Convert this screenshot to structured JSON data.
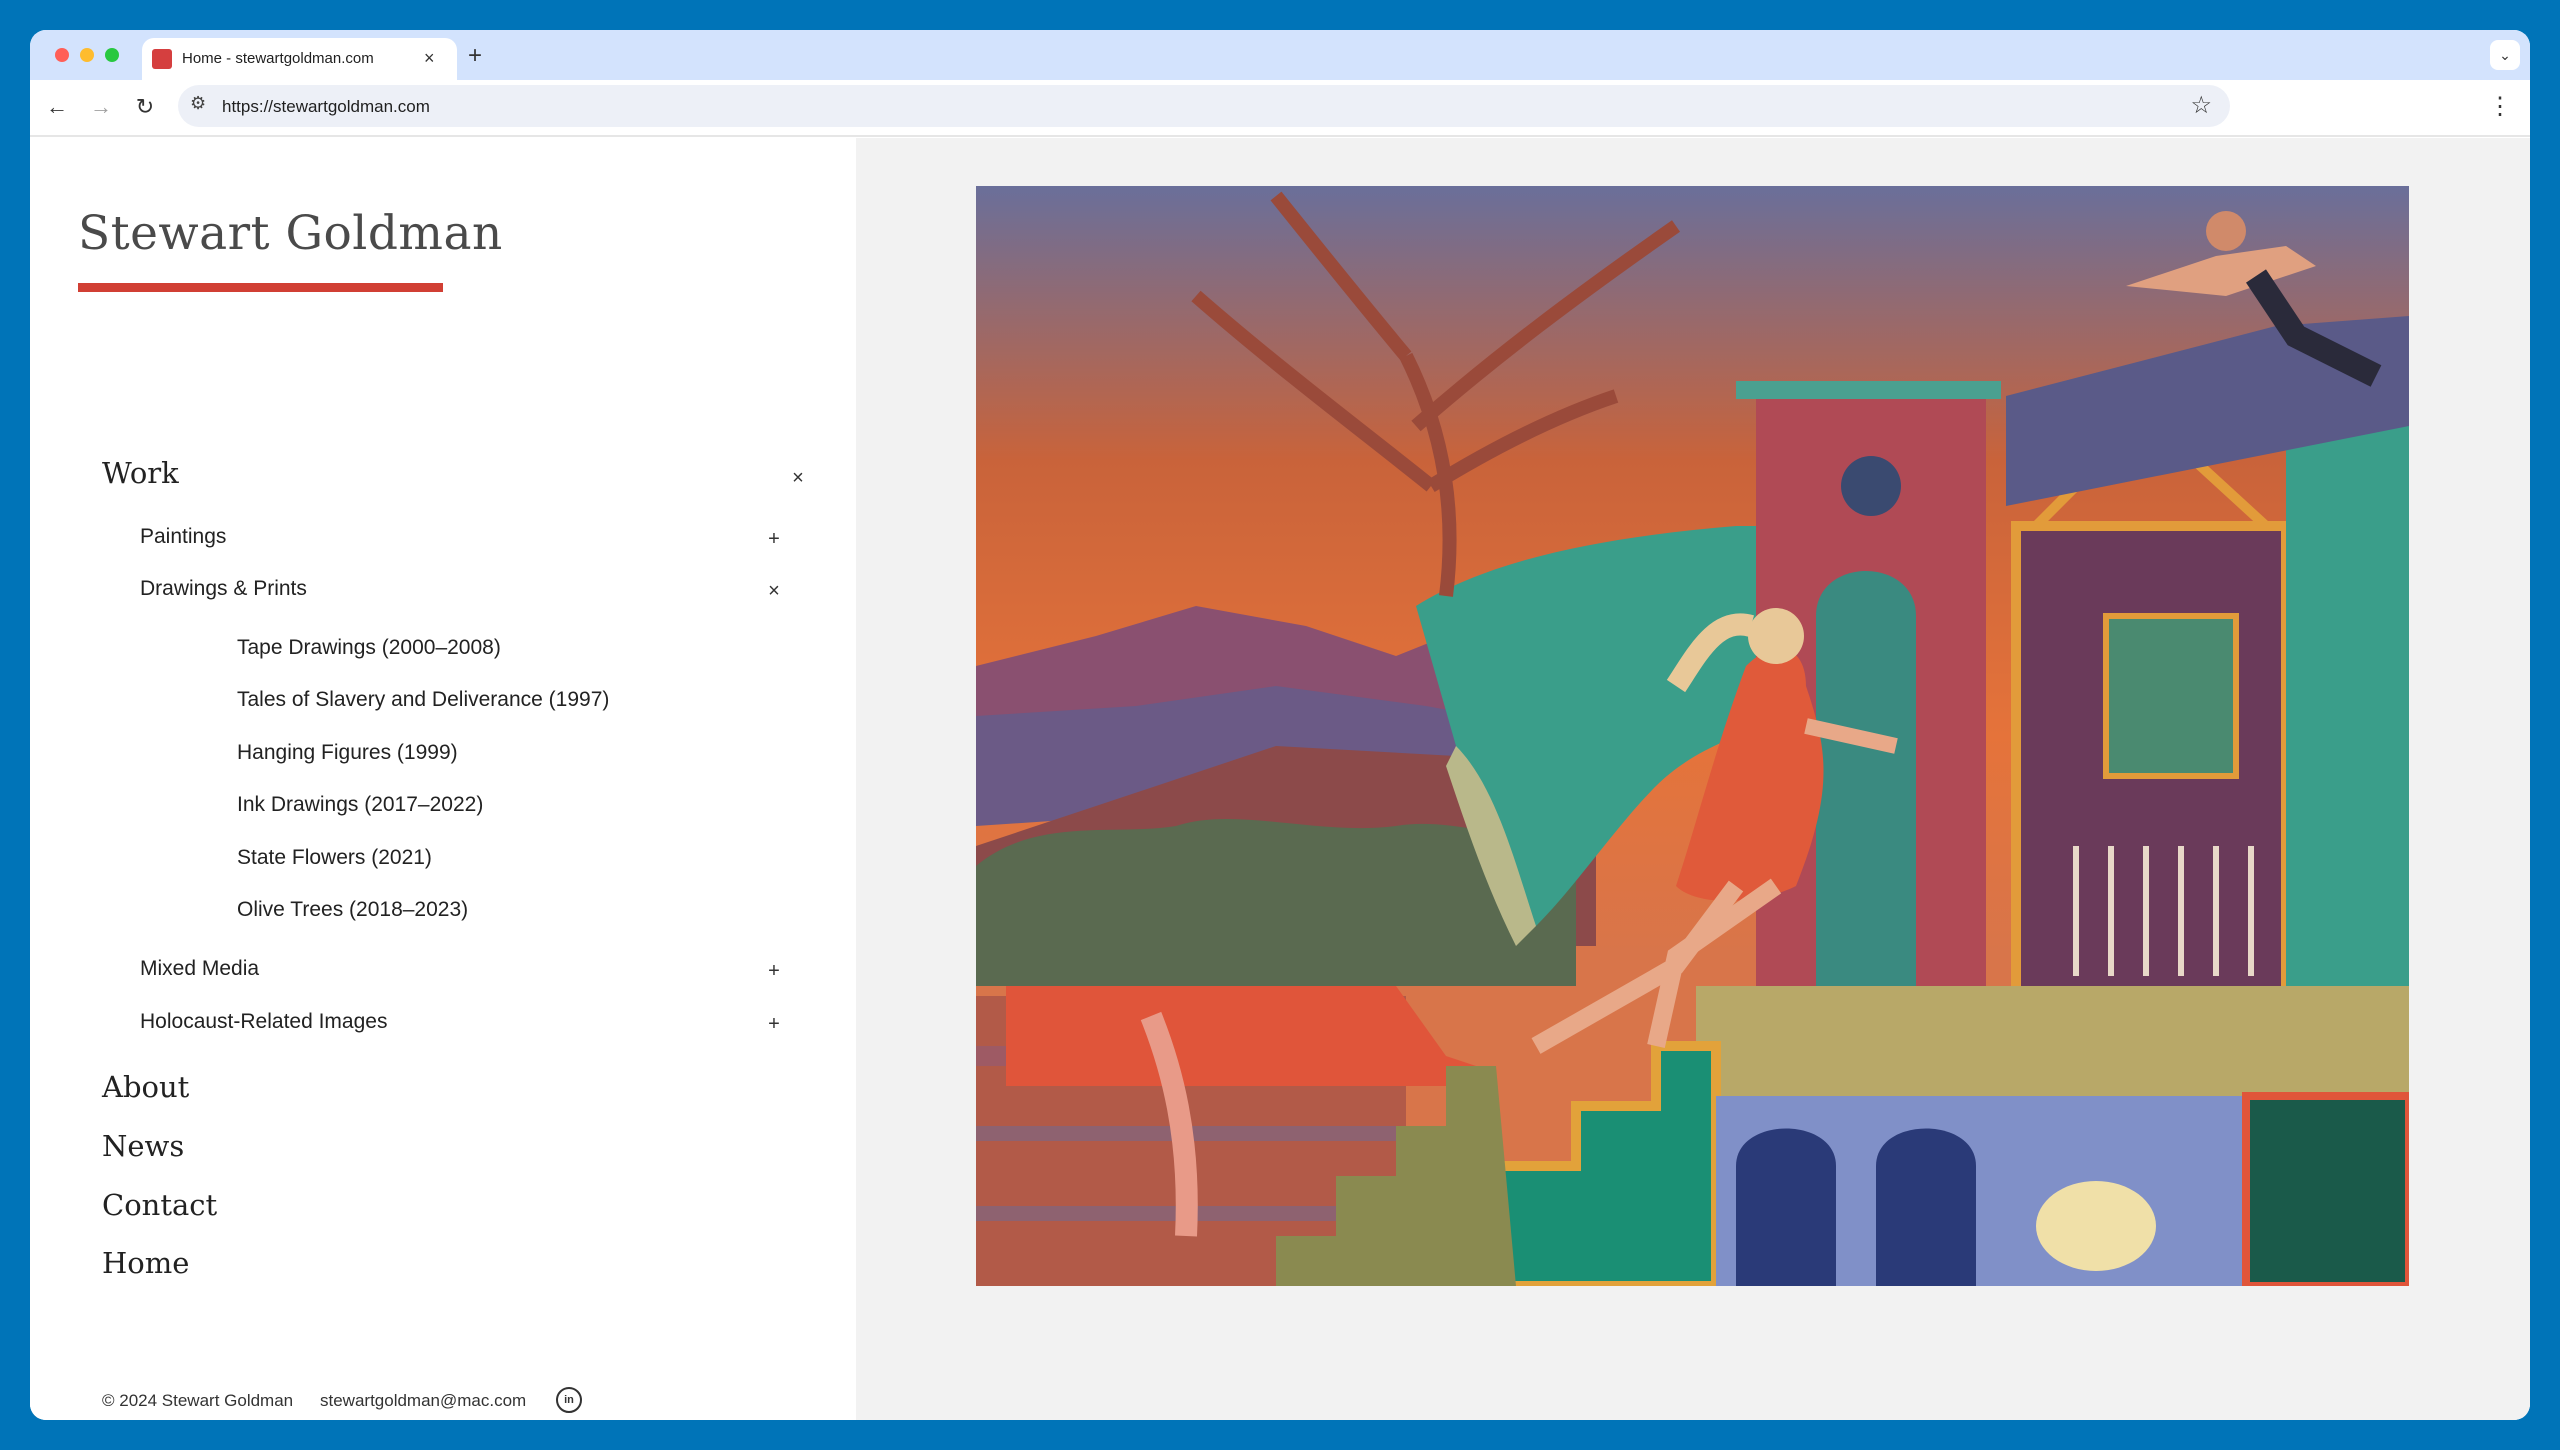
{
  "browser": {
    "tab_title": "Home - stewartgoldman.com",
    "tab_close": "×",
    "new_tab": "+",
    "tab_menu": "⌄",
    "url": "https://stewartgoldman.com",
    "icons": [
      "back-icon",
      "forward-icon",
      "reload-icon",
      "site-settings-icon",
      "star-icon",
      "kebab-menu-icon",
      "favicon"
    ],
    "colors": {
      "tab_strip": "#d3e3fd",
      "omnibox": "#edf0f7",
      "frame": "#0074b8"
    }
  },
  "site": {
    "title": "Stewart Goldman",
    "accent_color": "#d13f34"
  },
  "nav": {
    "work": {
      "label": "Work",
      "toggle": "×"
    },
    "paintings": {
      "label": "Paintings",
      "toggle": "+"
    },
    "drawings": {
      "label": "Drawings & Prints",
      "toggle": "×"
    },
    "drawings_items": [
      "Tape Drawings (2000–2008)",
      "Tales of Slavery and Deliverance (1997)",
      "Hanging Figures (1999)",
      "Ink Drawings (2017–2022)",
      "State Flowers (2021)",
      "Olive Trees (2018–2023)"
    ],
    "mixed_media": {
      "label": "Mixed Media",
      "toggle": "+"
    },
    "holocaust": {
      "label": "Holocaust-Related Images",
      "toggle": "+"
    },
    "about": "About",
    "news": "News",
    "contact": "Contact",
    "home": "Home"
  },
  "footer": {
    "copyright": "© 2024 Stewart Goldman",
    "email": "stewartgoldman@mac.com",
    "linkedin": "in"
  }
}
